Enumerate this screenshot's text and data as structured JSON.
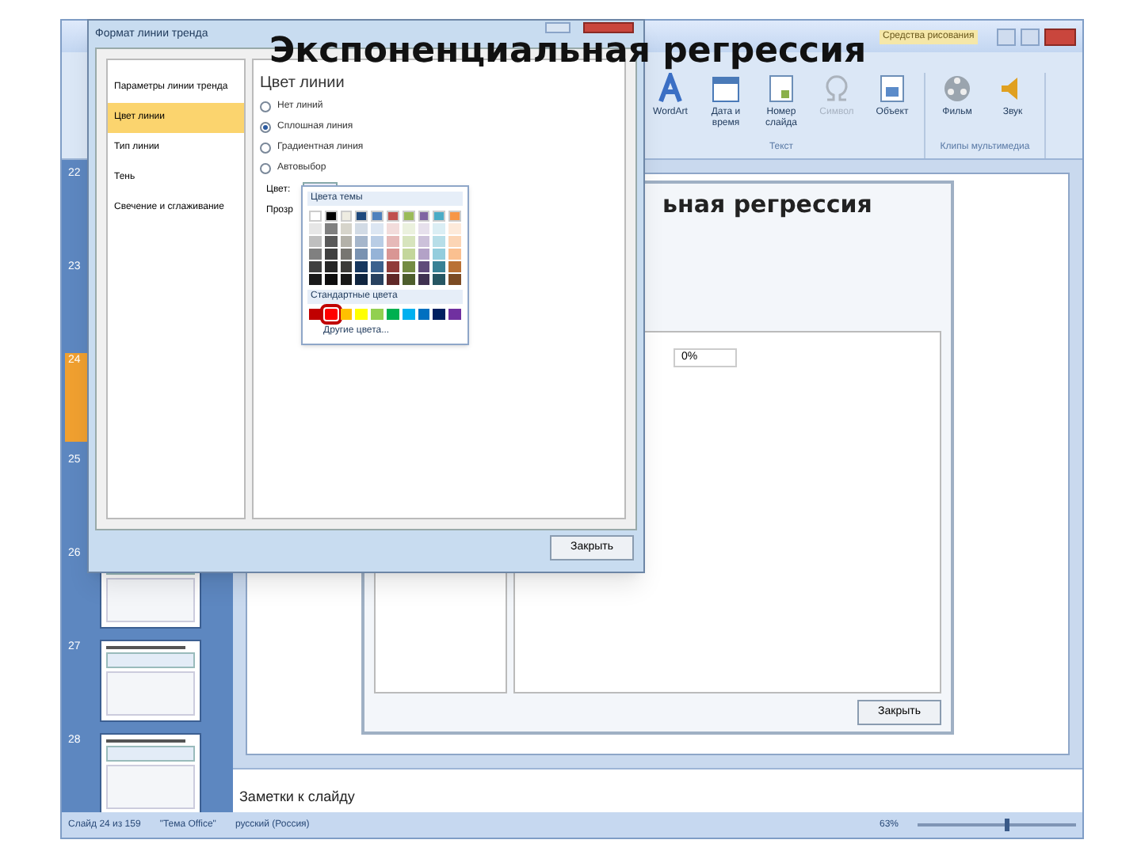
{
  "overlay_title": "Экспоненциальная регрессия",
  "app": {
    "context_tab": "Средства рисования",
    "ribbon_groups": [
      {
        "label": "Текст",
        "buttons": [
          {
            "label": "WordArt",
            "kind": "wordart",
            "disabled": false
          },
          {
            "label": "Дата и время",
            "kind": "calendar",
            "disabled": false
          },
          {
            "label": "Номер слайда",
            "kind": "number",
            "disabled": false
          },
          {
            "label": "Символ",
            "kind": "omega",
            "disabled": true
          },
          {
            "label": "Объект",
            "kind": "object",
            "disabled": false
          }
        ]
      },
      {
        "label": "Клипы мультимедиа",
        "buttons": [
          {
            "label": "Фильм",
            "kind": "film",
            "disabled": false
          },
          {
            "label": "Звук",
            "kind": "sound",
            "disabled": false
          }
        ]
      }
    ],
    "thumbnails": [
      {
        "number": "22",
        "selected": false
      },
      {
        "number": "23",
        "selected": false
      },
      {
        "number": "24",
        "selected": true
      },
      {
        "number": "25",
        "selected": false
      },
      {
        "number": "26",
        "selected": false
      },
      {
        "number": "27",
        "selected": false
      },
      {
        "number": "28",
        "selected": false
      }
    ],
    "slide": {
      "heading": "ьная регрессия",
      "percent": "0%",
      "button": "Закрыть"
    },
    "notes_placeholder": "Заметки к слайду",
    "status_bar": [
      "Слайд 24 из 159",
      "\"Тема Office\"",
      "русский (Россия)"
    ],
    "zoom": {
      "label": "63%",
      "level": 0.55
    }
  },
  "dialog": {
    "title": "Формат линии тренда",
    "nav": [
      {
        "label": "Параметры линии тренда",
        "selected": false
      },
      {
        "label": "Цвет линии",
        "selected": true
      },
      {
        "label": "Тип линии",
        "selected": false
      },
      {
        "label": "Тень",
        "selected": false
      },
      {
        "label": "Свечение и сглаживание",
        "selected": false
      }
    ],
    "heading": "Цвет линии",
    "options": [
      {
        "label": "Нет линий",
        "selected": false
      },
      {
        "label": "Сплошная линия",
        "selected": true
      },
      {
        "label": "Градиентная линия",
        "selected": false
      },
      {
        "label": "Автовыбор",
        "selected": false
      }
    ],
    "color_label": "Цвет:",
    "transparency_label": "Прозр",
    "close_button": "Закрыть"
  },
  "color_menu": {
    "theme_heading": "Цвета темы",
    "theme_colors": [
      {
        "color": "#ffffff"
      },
      {
        "color": "#000000"
      },
      {
        "color": "#eeece1"
      },
      {
        "color": "#1f497d"
      },
      {
        "color": "#4f81bd"
      },
      {
        "color": "#c0504d"
      },
      {
        "color": "#9bbb59"
      },
      {
        "color": "#8064a2"
      },
      {
        "color": "#4bacc6"
      },
      {
        "color": "#f79646"
      }
    ],
    "standard_heading": "Стандартные цвета",
    "standard_colors": [
      {
        "color": "#c00000",
        "selected": false
      },
      {
        "color": "#ff0000",
        "selected": true
      },
      {
        "color": "#ffc000",
        "selected": false
      },
      {
        "color": "#ffff00",
        "selected": false
      },
      {
        "color": "#92d050",
        "selected": false
      },
      {
        "color": "#00b050",
        "selected": false
      },
      {
        "color": "#00b0f0",
        "selected": false
      },
      {
        "color": "#0070c0",
        "selected": false
      },
      {
        "color": "#002060",
        "selected": false
      },
      {
        "color": "#7030a0",
        "selected": false
      }
    ],
    "more_colors": "Другие цвета..."
  }
}
